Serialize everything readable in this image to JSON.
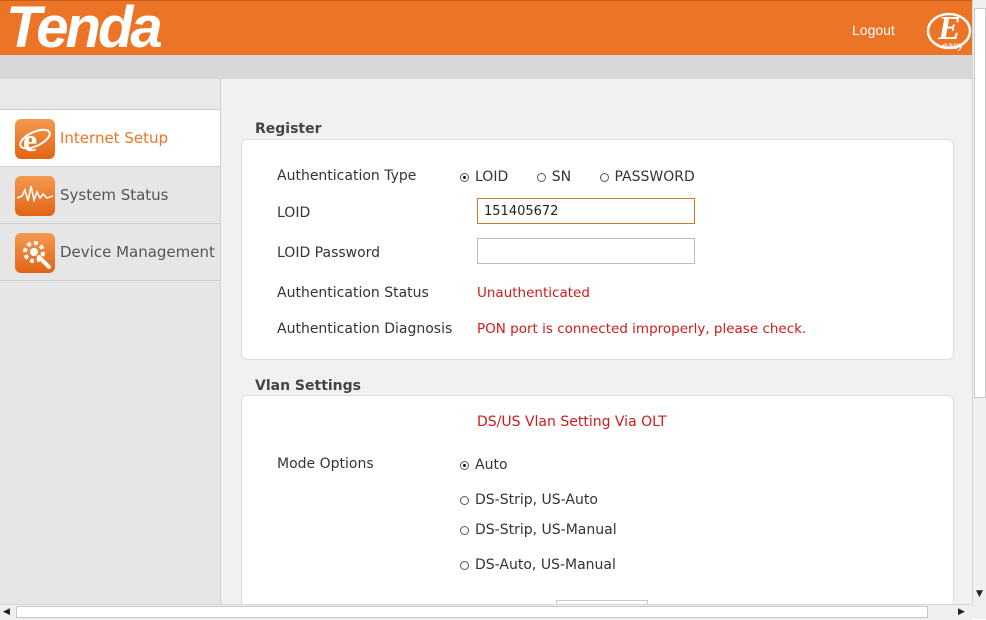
{
  "header": {
    "brand": "Tenda",
    "logout_label": "Logout",
    "corner_logo_text": "easylife",
    "brand_color": "#ec7426"
  },
  "sidebar": {
    "items": [
      {
        "label": "Internet Setup",
        "icon": "internet-explorer-icon",
        "active": true
      },
      {
        "label": "System Status",
        "icon": "waveform-icon",
        "active": false
      },
      {
        "label": "Device Management",
        "icon": "gear-wrench-icon",
        "active": false
      }
    ]
  },
  "register": {
    "title": "Register",
    "auth_type_label": "Authentication Type",
    "auth_options": [
      "LOID",
      "SN",
      "PASSWORD"
    ],
    "auth_selected": "LOID",
    "loid_label": "LOID",
    "loid_value": "151405672",
    "loid_password_label": "LOID Password",
    "loid_password_value": "",
    "status_label": "Authentication Status",
    "status_value": "Unauthenticated",
    "diagnosis_label": "Authentication Diagnosis",
    "diagnosis_value": "PON port is connected improperly, please check.",
    "alert_color": "#d11a1a"
  },
  "vlan": {
    "title": "Vlan Settings",
    "note": "DS/US Vlan Setting Via OLT",
    "mode_label": "Mode Options",
    "modes": [
      "Auto",
      "DS-Strip, US-Auto",
      "DS-Strip, US-Manual",
      "DS-Auto, US-Manual"
    ],
    "mode_selected": "Auto"
  }
}
